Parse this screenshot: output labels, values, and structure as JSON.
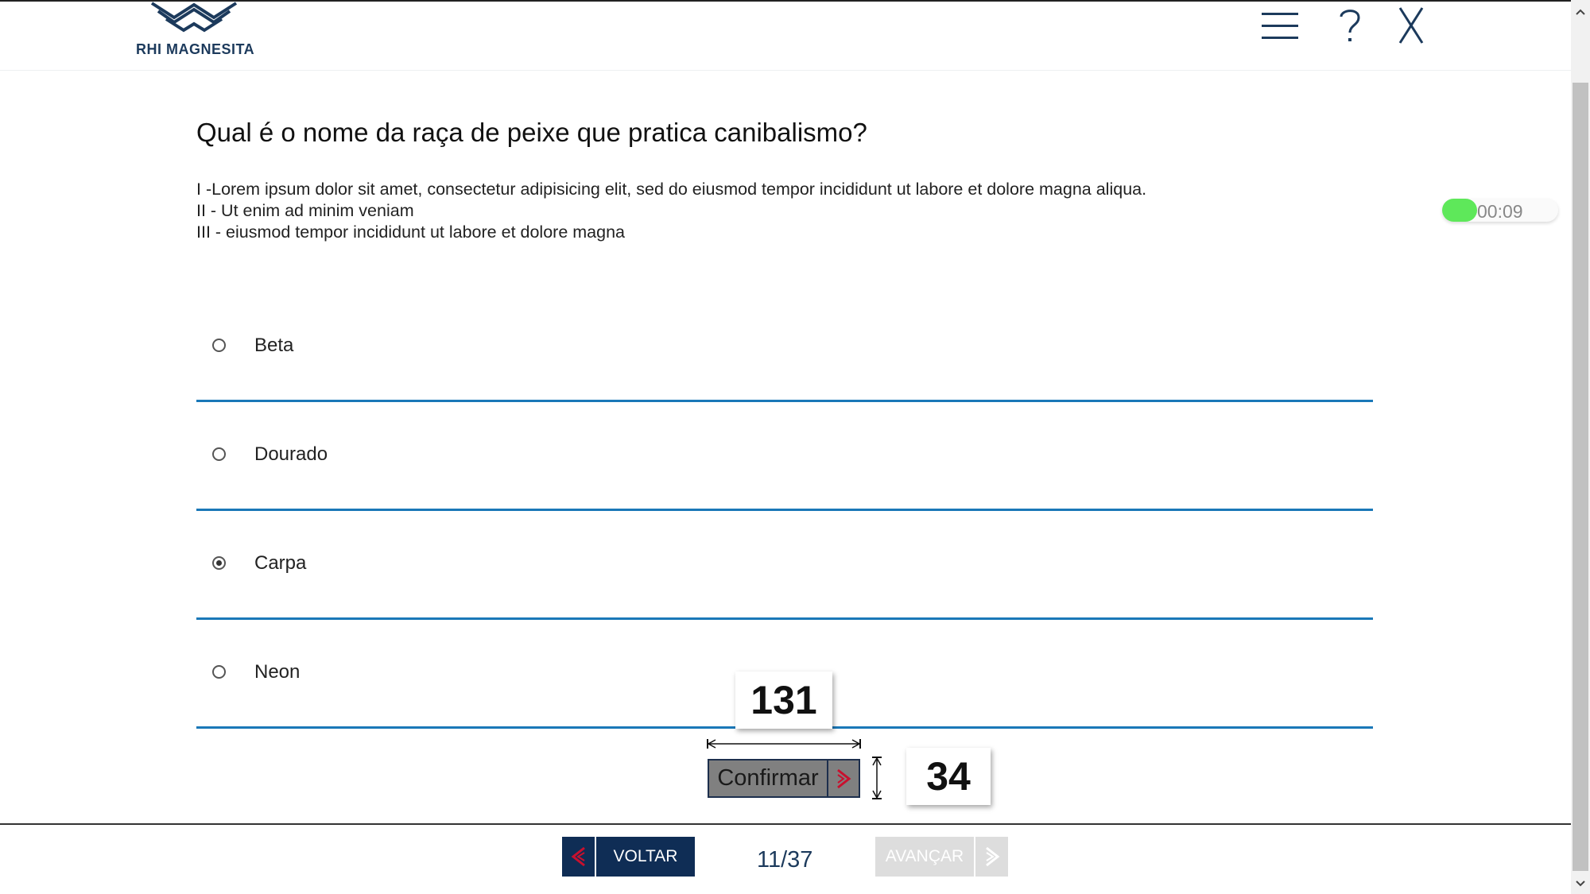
{
  "header": {
    "logo_text": "RHI MAGNESITA",
    "menu_icon": "hamburger-menu-icon",
    "help_icon": "question-mark-icon",
    "close_icon": "close-x-icon"
  },
  "question": {
    "title": "Qual é o nome da raça de peixe que pratica canibalismo?",
    "statements": [
      "I -Lorem ipsum dolor sit amet, consectetur adipisicing elit, sed do eiusmod tempor incididunt ut labore et dolore magna aliqua.",
      "II - Ut enim ad minim veniam",
      "III - eiusmod tempor incididunt ut labore et dolore magna"
    ]
  },
  "timer": {
    "text": "00:09",
    "fill_fraction": 0.3,
    "fill_color": "#5ee85a"
  },
  "options": [
    {
      "label": "Beta",
      "selected": false
    },
    {
      "label": "Dourado",
      "selected": false
    },
    {
      "label": "Carpa",
      "selected": true
    },
    {
      "label": "Neon",
      "selected": false
    }
  ],
  "confirm": {
    "label": "Confirmar",
    "arrow_color": "#c8102e"
  },
  "dimensions": {
    "width_label": "131",
    "height_label": "34"
  },
  "footer": {
    "back_label": "VOLTAR",
    "page_indicator": "11/37",
    "next_label": "AVANÇAR"
  },
  "colors": {
    "brand_navy": "#0f2d55",
    "accent_red": "#c8102e",
    "divider_blue": "#1a78b8"
  }
}
